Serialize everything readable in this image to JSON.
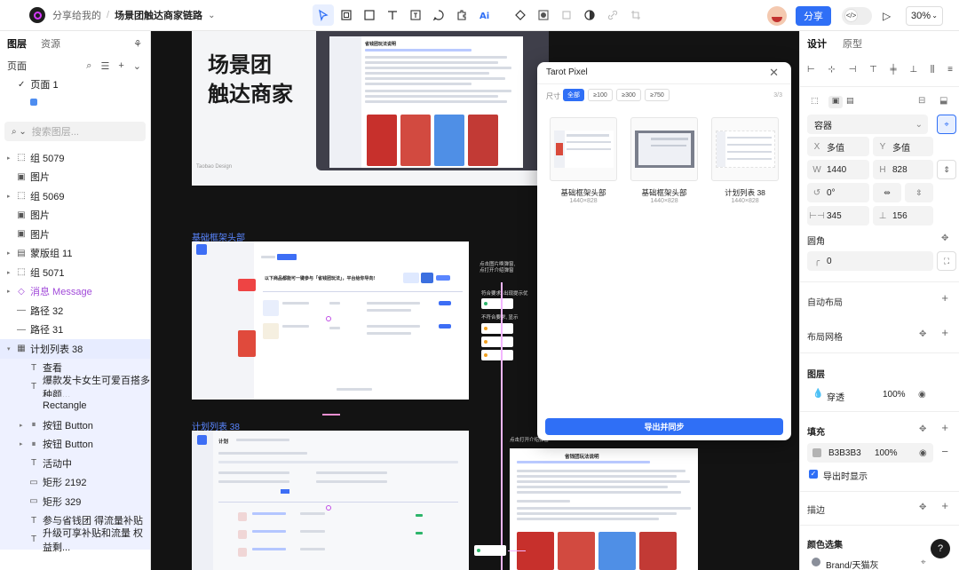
{
  "header": {
    "crumb_share": "分享给我的",
    "crumb_sep": "/",
    "crumb_file": "场景团触达商家链路",
    "share_label": "分享",
    "code_icon": "</>",
    "zoom": "30%"
  },
  "left": {
    "tab_design": "图层",
    "tab_assets": "资源",
    "pages_label": "页面",
    "page_item": "页面 1",
    "search_placeholder": "搜索图层...",
    "layers": [
      {
        "name": "组 5079",
        "icon": "⬚",
        "caret": "▸",
        "indent": 0
      },
      {
        "name": "图片",
        "icon": "▣",
        "caret": "",
        "indent": 0
      },
      {
        "name": "组 5069",
        "icon": "⬚",
        "caret": "▸",
        "indent": 0
      },
      {
        "name": "图片",
        "icon": "▣",
        "caret": "",
        "indent": 0
      },
      {
        "name": "图片",
        "icon": "▣",
        "caret": "",
        "indent": 0
      },
      {
        "name": "蒙版组 11",
        "icon": "▤",
        "caret": "▸",
        "indent": 0
      },
      {
        "name": "组 5071",
        "icon": "⬚",
        "caret": "▸",
        "indent": 0
      },
      {
        "name": "消息 Message",
        "icon": "◇",
        "caret": "▸",
        "indent": 0
      },
      {
        "name": "路径 32",
        "icon": "—",
        "caret": "",
        "indent": 0
      },
      {
        "name": "路径 31",
        "icon": "—",
        "caret": "",
        "indent": 0
      },
      {
        "name": "计划列表 38",
        "icon": "▦",
        "caret": "▾",
        "indent": 0
      },
      {
        "name": "查看",
        "icon": "T",
        "caret": "",
        "indent": 1
      },
      {
        "name": "爆款发卡女生可爱百搭多种颜...",
        "icon": "T",
        "caret": "",
        "indent": 1
      },
      {
        "name": "Rectangle",
        "icon": "",
        "caret": "",
        "indent": 1
      },
      {
        "name": "按钮 Button",
        "icon": "⏸",
        "caret": "▸",
        "indent": 1
      },
      {
        "name": "按钮 Button",
        "icon": "⏸",
        "caret": "▸",
        "indent": 1
      },
      {
        "name": "活动中",
        "icon": "T",
        "caret": "",
        "indent": 1
      },
      {
        "name": "矩形 2192",
        "icon": "▭",
        "caret": "",
        "indent": 1
      },
      {
        "name": "矩形 329",
        "icon": "▭",
        "caret": "",
        "indent": 1
      },
      {
        "name": "参与省钱团 得流量补贴",
        "icon": "T",
        "caret": "",
        "indent": 1
      },
      {
        "name": "升级可享补贴和流量 权益剩...",
        "icon": "T",
        "caret": "",
        "indent": 1
      }
    ]
  },
  "canvas": {
    "big_title_1": "场景团",
    "big_title_2": "触达商家",
    "footer_small": "Taobao Design",
    "frame2_label": "基础框架头部",
    "frame3_label": "计划列表 38",
    "frame2_notes": [
      "点击图片唤弹窗,",
      "点打开介绍弹窗"
    ],
    "frame2_note2": "符合要求, 出现提示优",
    "frame2_note3": "不符合要求, 显示",
    "frame4_note": "点击打开介绍弹窗",
    "doc_title": "省钱团玩法说明",
    "frame2_heading": "以下商品都能可一键参与「省钱团玩法」，平台给你导向!",
    "frame3_heading": "计划",
    "frame4_title": "省钱团玩法说明"
  },
  "modal": {
    "title": "Tarot Pixel",
    "size_label": "尺寸",
    "filters": [
      "全部",
      "≥100",
      "≥300",
      "≥750"
    ],
    "pager": "3/3",
    "cards": [
      {
        "name": "基础框架头部",
        "size": "1440×828"
      },
      {
        "name": "基础框架头部",
        "size": "1440×828"
      },
      {
        "name": "计划列表 38",
        "size": "1440×828"
      }
    ],
    "export_label": "导出并同步"
  },
  "right": {
    "tab_design": "设计",
    "tab_proto": "原型",
    "container_label": "容器",
    "x_label": "X",
    "x_value": "多值",
    "y_label": "Y",
    "y_value": "多值",
    "w_label": "W",
    "w_value": "1440",
    "h_label": "H",
    "h_value": "828",
    "rotation": "0°",
    "spacing_1": "345",
    "spacing_2": "156",
    "radius_label": "圆角",
    "radius_value": "0",
    "autolayout_label": "自动布局",
    "grid_label": "布局网格",
    "layer_label": "图层",
    "blend_mode": "穿透",
    "opacity": "100%",
    "fill_label": "填充",
    "fill_hex": "B3B3B3",
    "fill_opacity": "100%",
    "fill_color": "#b3b3b3",
    "export_visible": "导出时显示",
    "stroke_label": "描边",
    "colorsel_label": "颜色选集",
    "brand_color": "Brand/天猫灰",
    "help": "?"
  },
  "colors": {
    "accent": "#2f6ff6",
    "canvas_bg": "#131313",
    "label_blue": "#5a86ff",
    "purple": "#a14ad9"
  }
}
